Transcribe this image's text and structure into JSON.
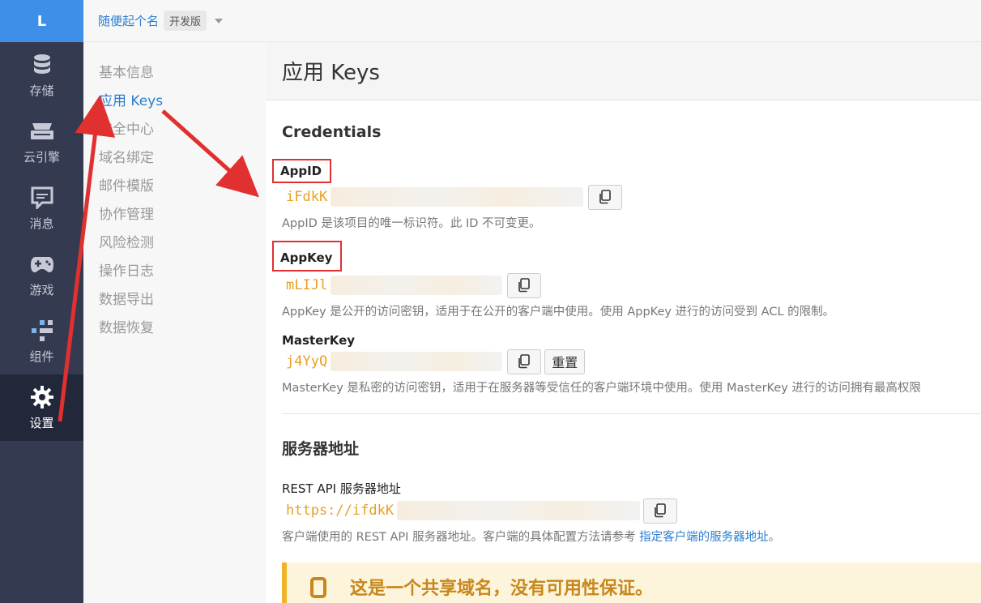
{
  "rail": {
    "logo": "L",
    "items": [
      {
        "label": "存储",
        "icon": "database-icon"
      },
      {
        "label": "云引擎",
        "icon": "cloud-engine-icon"
      },
      {
        "label": "消息",
        "icon": "message-icon"
      },
      {
        "label": "游戏",
        "icon": "gamepad-icon"
      },
      {
        "label": "组件",
        "icon": "components-icon"
      },
      {
        "label": "设置",
        "icon": "gear-icon",
        "active": true
      }
    ]
  },
  "topbar": {
    "app_name": "随便起个名",
    "badge": "开发版"
  },
  "subnav": {
    "items": [
      "基本信息",
      "应用 Keys",
      "安全中心",
      "域名绑定",
      "邮件模版",
      "协作管理",
      "风险检测",
      "操作日志",
      "数据导出",
      "数据恢复"
    ],
    "active_index": 1
  },
  "page": {
    "title": "应用 Keys"
  },
  "credentials": {
    "title": "Credentials",
    "appid": {
      "label": "AppID",
      "value": "iFdkK",
      "help": "AppID 是该项目的唯一标识符。此 ID 不可变更。"
    },
    "appkey": {
      "label": "AppKey",
      "value": "mLIJl",
      "help": "AppKey 是公开的访问密钥，适用于在公开的客户端中使用。使用 AppKey 进行的访问受到 ACL 的限制。"
    },
    "masterkey": {
      "label": "MasterKey",
      "value": "j4YyQ",
      "reset_label": "重置",
      "help": "MasterKey 是私密的访问密钥，适用于在服务器等受信任的客户端环境中使用。使用 MasterKey 进行的访问拥有最高权限"
    }
  },
  "server": {
    "title": "服务器地址",
    "rest_label": "REST API 服务器地址",
    "rest_value": "https://ifdkK",
    "help_prefix": "客户端使用的 REST API 服务器地址。客户端的具体配置方法请参考 ",
    "help_link": "指定客户端的服务器地址",
    "help_suffix": "。",
    "warning": "这是一个共享域名，没有可用性保证。"
  },
  "colors": {
    "accent": "#2a7ed0",
    "rail_bg": "#343a50",
    "key_color": "#e8a023",
    "highlight": "#e03030"
  }
}
